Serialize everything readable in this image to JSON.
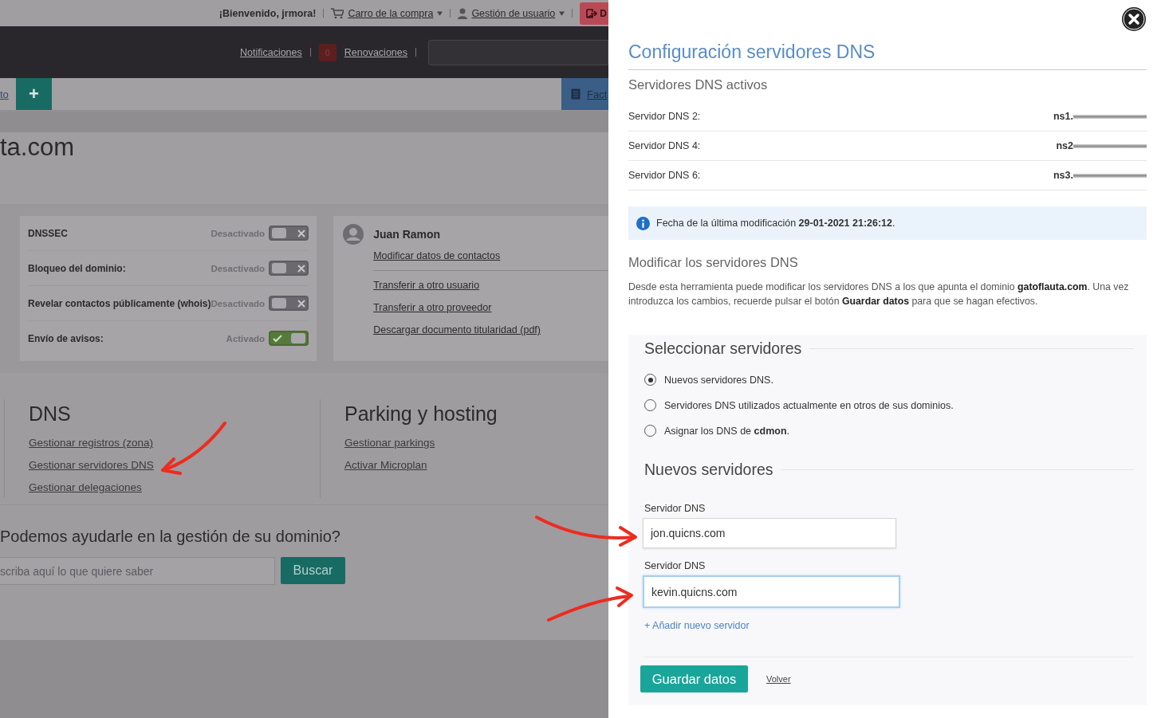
{
  "header": {
    "welcome": "¡Bienvenido, jrmora!",
    "links": [
      "Carro de la compra",
      "Gestión de usuario"
    ],
    "logout": "D"
  },
  "nav": {
    "links": [
      "Notificaciones",
      "Renovaciones"
    ],
    "badge": "0"
  },
  "toolbar": {
    "link": "to",
    "add": "+",
    "invoices": "Fact"
  },
  "domain_title": "ta.com",
  "settings": [
    {
      "label": "DNSSEC",
      "status": "Desactivado",
      "on": false
    },
    {
      "label": "Bloqueo del dominio:",
      "status": "Desactivado",
      "on": false
    },
    {
      "label": "Revelar contactos públicamente (whois)",
      "status": "Desactivado",
      "on": false
    },
    {
      "label": "Envío de avisos:",
      "status": "Activado",
      "on": true
    }
  ],
  "contact": {
    "name": "Juan Ramon",
    "links": [
      "Modificar datos de contactos",
      "Transferir a otro usuario",
      "Transferir a otro proveedor",
      "Descargar documento titularidad (pdf)"
    ]
  },
  "sections": [
    {
      "title": "DNS",
      "links": [
        "Gestionar registros (zona)",
        "Gestionar servidores DNS",
        "Gestionar delegaciones"
      ]
    },
    {
      "title": "Parking y hosting",
      "links": [
        "Gestionar parkings",
        "Activar Microplan"
      ]
    }
  ],
  "help": {
    "title": "Podemos ayudarle en la gestión de su dominio?",
    "placeholder": "scriba aquí lo que quiere saber",
    "button": "Buscar"
  },
  "panel": {
    "title": "Configuración servidores DNS",
    "active_title": "Servidores DNS activos",
    "servers": [
      {
        "label": "Servidor DNS 2:",
        "value": "ns1."
      },
      {
        "label": "Servidor DNS 4:",
        "value": "ns2"
      },
      {
        "label": "Servidor DNS 6:",
        "value": "ns3."
      }
    ],
    "info": "Fecha de la última modificación **29-01-2021 21:26:12**.",
    "modify_title": "Modificar los servidores DNS",
    "description": "Desde esta herramienta puede modificar los servidores DNS a los que apunta el dominio **gatoflauta.com**. Una vez introduzca los cambios, recuerde pulsar el botón **Guardar datos** para que se hagan efectivos.",
    "select_title": "Seleccionar servidores",
    "options": [
      {
        "label": "Nuevos servidores DNS.",
        "selected": true
      },
      {
        "label": "Servidores DNS utilizados actualmente en otros de sus dominios.",
        "selected": false
      },
      {
        "label": "Asignar los DNS de **cdmon**.",
        "selected": false
      }
    ],
    "new_title": "Nuevos servidores",
    "fields": [
      {
        "label": "Servidor DNS",
        "value": "jon.quicns.com",
        "focused": false
      },
      {
        "label": "Servidor DNS",
        "value": "kevin.quicns.com",
        "focused": true
      }
    ],
    "add_link": "+ Añadir nuevo servidor",
    "save": "Guardar datos",
    "back": "Volver"
  }
}
